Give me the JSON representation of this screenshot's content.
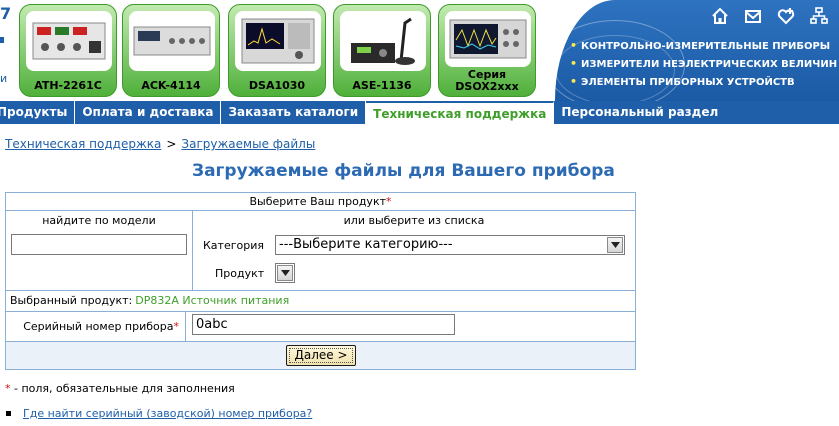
{
  "header": {
    "logo_digit": "7",
    "logo_char": "и",
    "products": [
      {
        "label": "ATH-2261C"
      },
      {
        "label": "ACK-4114"
      },
      {
        "label": "DSA1030"
      },
      {
        "label": "ASE-1136"
      },
      {
        "label": "Серия",
        "label2": "DSOX2xxx"
      }
    ],
    "top_icons": [
      "home-icon",
      "mail-icon",
      "heart-plus-icon",
      "sitemap-icon"
    ],
    "bullets": [
      "КОНТРОЛЬНО-ИЗМЕРИТЕЛЬНЫЕ ПРИБОРЫ",
      "ИЗМЕРИТЕЛИ НЕЭЛЕКТРИЧЕСКИХ ВЕЛИЧИН",
      "ЭЛЕМЕНТЫ ПРИБОРНЫХ УСТРОЙСТВ"
    ],
    "bullet_color": "#ffe84a"
  },
  "nav": {
    "items": [
      {
        "label": "Продукты"
      },
      {
        "label": "Оплата и доставка"
      },
      {
        "label": "Заказать каталоги"
      },
      {
        "label": "Техническая поддержка"
      },
      {
        "label": "Персональный раздел"
      }
    ],
    "active_index": 3
  },
  "breadcrumb": {
    "items": [
      "Техническая поддержка",
      "Загружаемые файлы"
    ],
    "separator": ">"
  },
  "page_title": "Загружаемые файлы для Вашего прибора",
  "form": {
    "header_label": "Выберите Ваш продукт",
    "required_mark": "*",
    "by_model_caption": "найдите по модели",
    "model_value": "",
    "from_list_caption": "или выберите из списка",
    "category_label": "Категория",
    "category_selected": "---Выберите категорию---",
    "product_label": "Продукт",
    "product_selected": "",
    "selected_label": "Выбранный продукт:",
    "selected_value": "DP832A Источник питания",
    "serial_label": "Серийный номер прибора",
    "serial_value": "0abc",
    "next_label": "Далее >"
  },
  "footnote": {
    "star": "*",
    "text": " - поля, обязательные для заполнения"
  },
  "help_link": "Где найти серийный (заводской) номер прибора?",
  "colors": {
    "nav_bg": "#1f5ea8",
    "accent_green": "#3f9f2a",
    "title_blue": "#2d6ab4",
    "required_red": "#d01010"
  }
}
